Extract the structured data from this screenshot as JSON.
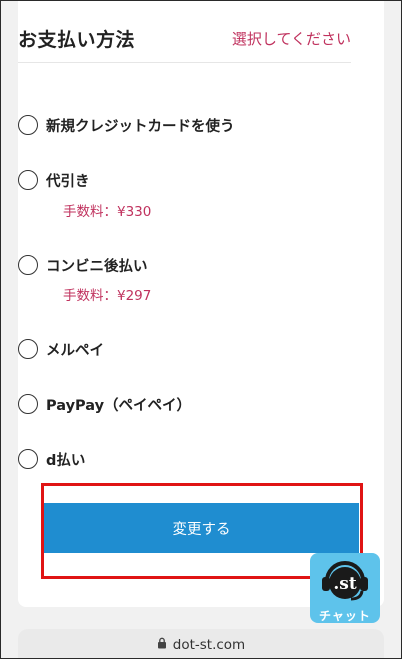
{
  "header": {
    "title": "お支払い方法",
    "select_prompt": "選択してください"
  },
  "options": [
    {
      "label": "新規クレジットカードを使う"
    },
    {
      "label": "代引き",
      "fee": "手数料：¥330"
    },
    {
      "label": "コンビニ後払い",
      "fee": "手数料：¥297"
    },
    {
      "label": "メルペイ"
    },
    {
      "label": "PayPay（ペイペイ）"
    },
    {
      "label": "d払い"
    }
  ],
  "change_button": {
    "label": "変更する"
  },
  "chat": {
    "label": "チャット",
    "icon": "headset-chat-icon"
  },
  "browser": {
    "url": "dot-st.com",
    "icon": "lock-icon"
  },
  "colors": {
    "accent": "#c0325e",
    "button": "#1f8dd0",
    "highlight": "#e01414",
    "chat": "#5ec3eb"
  }
}
